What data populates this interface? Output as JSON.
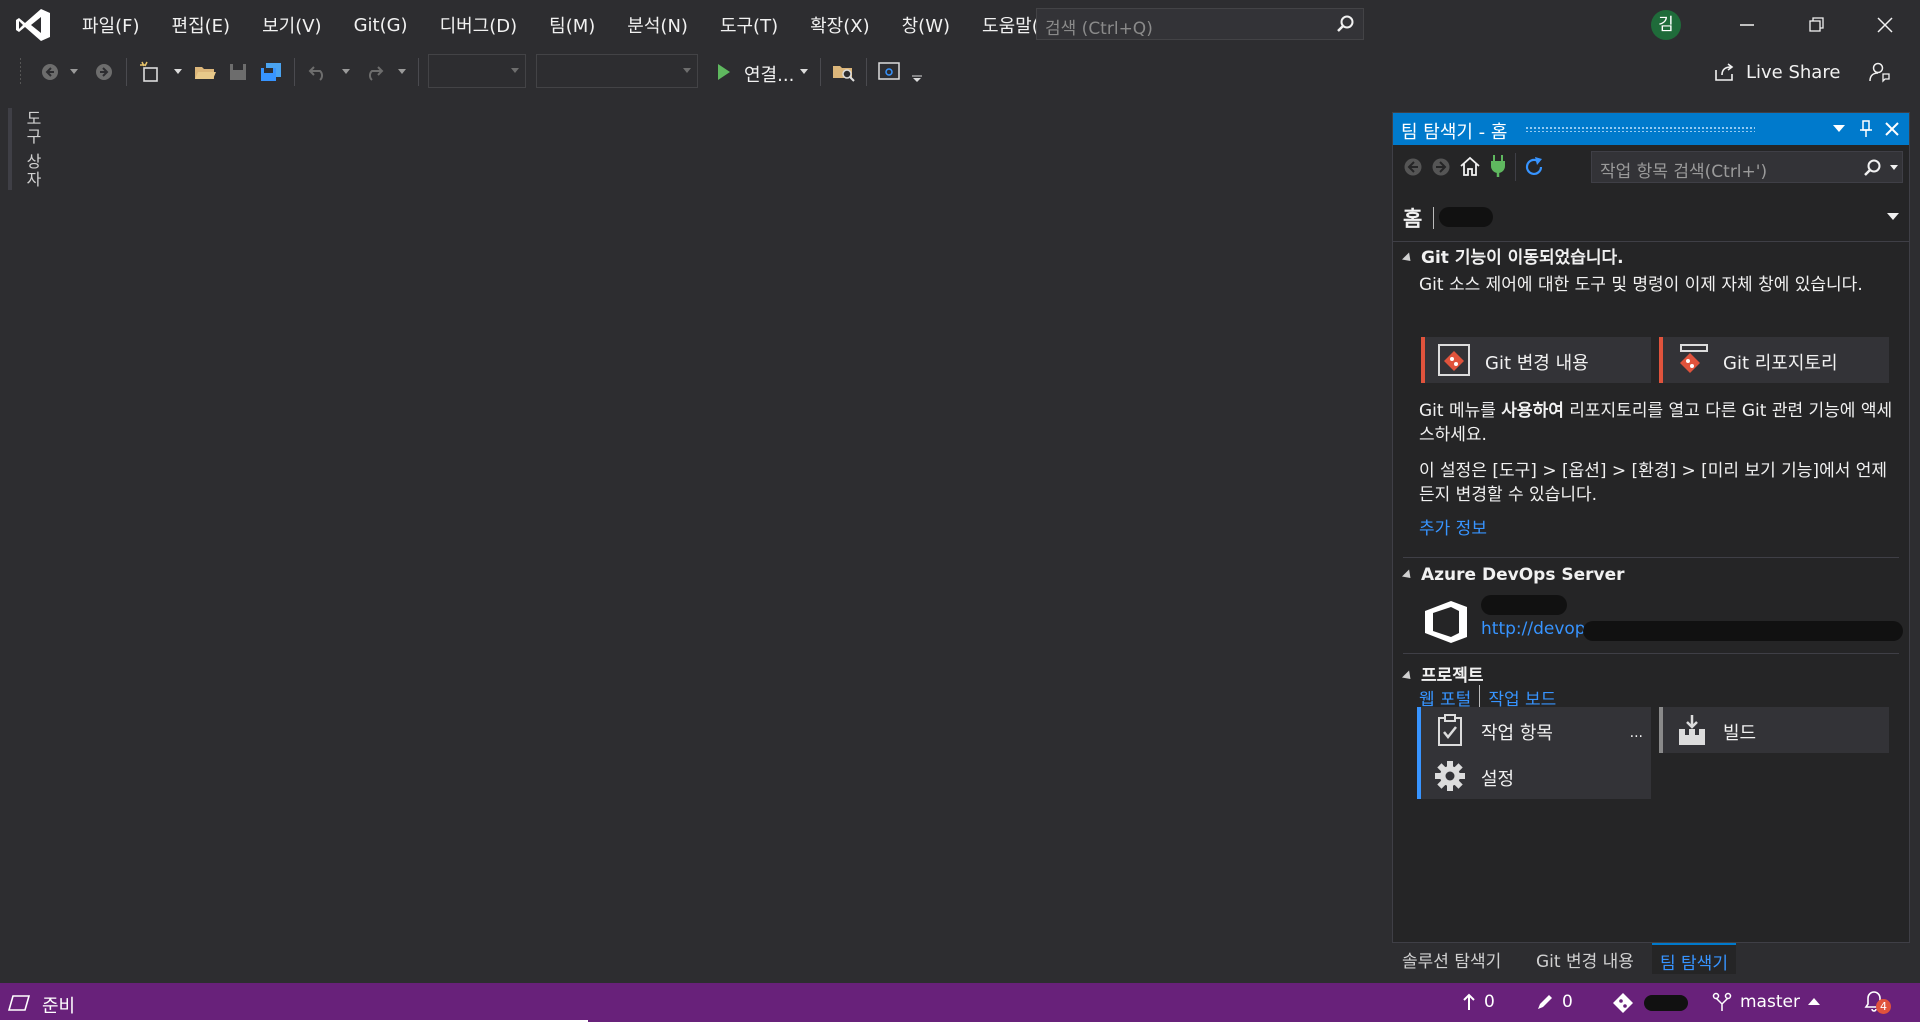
{
  "menu": [
    "파일(F)",
    "편집(E)",
    "보기(V)",
    "Git(G)",
    "디버그(D)",
    "팀(M)",
    "분석(N)",
    "도구(T)",
    "확장(X)",
    "창(W)",
    "도움말(H)"
  ],
  "search": {
    "placeholder": "검색 (Ctrl+Q)"
  },
  "account": {
    "initial": "김"
  },
  "toolbar": {
    "run_label": "연결...",
    "live_share_label": "Live Share"
  },
  "toolbox": {
    "label": "도구 상자"
  },
  "team_explorer": {
    "title": "팀 탐색기 - 홈",
    "search_placeholder": "작업 항목 검색(Ctrl+')",
    "home_label": "홈",
    "git_section": {
      "title": "Git 기능이 이동되었습니다.",
      "desc": "Git 소스 제어에 대한 도구 및 명령이 이제 자체 창에 있습니다.",
      "tiles": [
        "Git 변경 내용",
        "Git 리포지토리"
      ],
      "menu_text_a": "Git 메뉴를 ",
      "menu_text_bold": "사용하여",
      "menu_text_b": " 리포지토리를 열고 다른 Git 관련 기능에 액세스하세요.",
      "settings_text": "이 설정은 [도구] > [옵션] > [환경] > [미리 보기 기능]에서 언제든지 변경할 수 있습니다.",
      "more_info": "추가 정보"
    },
    "azure_section": {
      "title": "Azure DevOps Server",
      "url": "http://devops"
    },
    "project_section": {
      "title": "프로젝트",
      "links": [
        "웹 포털",
        "작업 보드"
      ],
      "tiles": [
        "작업 항목",
        "빌드",
        "설정"
      ],
      "more": "..."
    }
  },
  "bottom_tabs": [
    "솔루션 탐색기",
    "Git 변경 내용",
    "팀 탐색기"
  ],
  "status": {
    "ready": "준비",
    "up_count": "0",
    "pending_count": "0",
    "branch": "master",
    "notifications": "4"
  },
  "colors": {
    "accent": "#007acc",
    "status_bar": "#68217a",
    "git_tile": "#e0533c",
    "link": "#3794ff"
  }
}
